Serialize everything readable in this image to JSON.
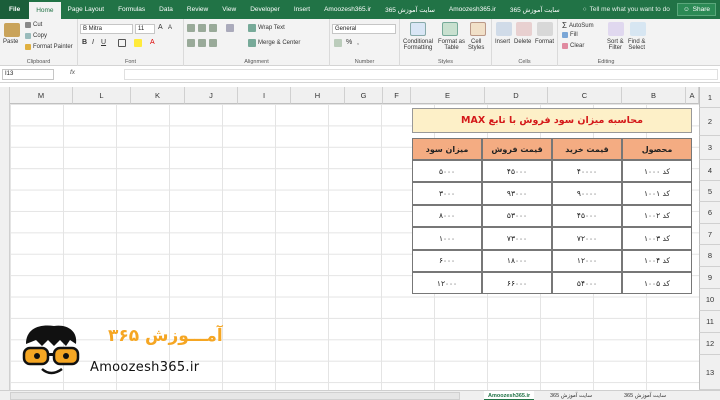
{
  "tabs": [
    "File",
    "Home",
    "Page Layout",
    "Formulas",
    "Data",
    "Review",
    "View",
    "Developer",
    "Insert",
    "Amoozesh365.ir",
    "سایت آموزش 365",
    "Amoozesh365.ir",
    "سایت آموزش 365"
  ],
  "tell_me": "Tell me what you want to do",
  "share": "Share",
  "ribbon": {
    "clipboard": {
      "paste": "Paste",
      "cut": "Cut",
      "copy": "Copy",
      "format_painter": "Format Painter",
      "label": "Clipboard"
    },
    "font": {
      "name": "B Mitra",
      "size": "11",
      "label": "Font"
    },
    "alignment": {
      "wrap": "Wrap Text",
      "merge": "Merge & Center",
      "label": "Alignment"
    },
    "number": {
      "format": "General",
      "label": "Number"
    },
    "styles": {
      "cond": "Conditional",
      "cond2": "Formatting",
      "table": "Format as",
      "table2": "Table",
      "cell": "Cell",
      "cell2": "Styles",
      "label": "Styles"
    },
    "cells": {
      "insert": "Insert",
      "delete": "Delete",
      "format": "Format",
      "label": "Cells"
    },
    "editing": {
      "autosum": "AutoSum",
      "fill": "Fill",
      "clear": "Clear",
      "sort": "Sort &",
      "sort2": "Filter",
      "find": "Find &",
      "find2": "Select",
      "label": "Editing"
    }
  },
  "name_box": "I13",
  "fx": "fx",
  "columns": [
    "M",
    "L",
    "K",
    "J",
    "I",
    "H",
    "G",
    "F",
    "E",
    "D",
    "C",
    "B",
    "A"
  ],
  "rows": [
    "1",
    "2",
    "3",
    "4",
    "5",
    "6",
    "7",
    "8",
    "9",
    "10",
    "11",
    "12",
    "13"
  ],
  "table": {
    "title": "محاسبه میزان سود فروش با تابع MAX",
    "headers": [
      "محصول",
      "قیمت خرید",
      "قیمت فروش",
      "میزان سود"
    ],
    "rows": [
      [
        "کد ۱۰۰۰",
        "۴۰۰۰۰",
        "۴۵۰۰۰",
        "۵۰۰۰"
      ],
      [
        "کد ۱۰۰۱",
        "۹۰۰۰۰",
        "۹۳۰۰۰",
        "۳۰۰۰"
      ],
      [
        "کد ۱۰۰۲",
        "۴۵۰۰۰",
        "۵۳۰۰۰",
        "۸۰۰۰"
      ],
      [
        "کد ۱۰۰۳",
        "۷۲۰۰۰",
        "۷۳۰۰۰",
        "۱۰۰۰"
      ],
      [
        "کد ۱۰۰۴",
        "۱۲۰۰۰",
        "۱۸۰۰۰",
        "۶۰۰۰"
      ],
      [
        "کد ۱۰۰۵",
        "۵۴۰۰۰",
        "۶۶۰۰۰",
        "۱۲۰۰۰"
      ]
    ]
  },
  "logo": {
    "fa": "آمـــوزش ۳۶۵",
    "en": "Amoozesh365.ir"
  },
  "sheet_tabs": [
    "Amoozesh365.ir",
    "سایت آموزش 365",
    "سایت آموزش 365"
  ],
  "colors": {
    "excel_green": "#217346",
    "title_bg": "#fdf0c8",
    "title_text": "#d4191a",
    "header_bg": "#f4ac82",
    "logo_orange": "#f5a623"
  }
}
